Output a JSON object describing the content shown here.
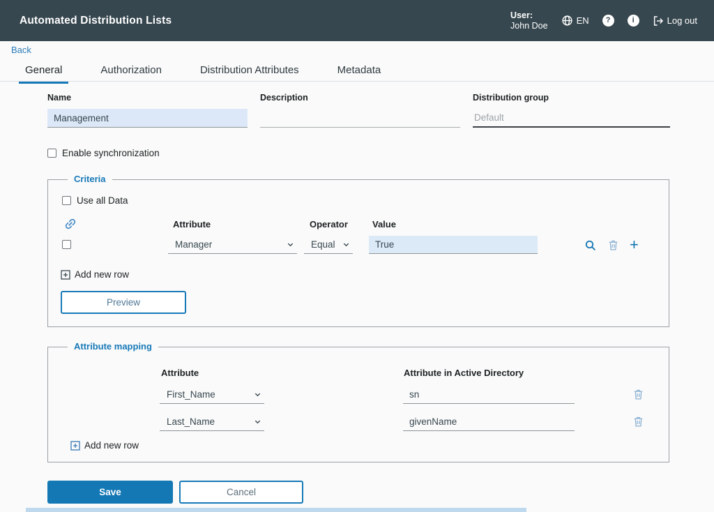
{
  "header": {
    "title": "Automated Distribution Lists",
    "user_label": "User:",
    "user_name": "John Doe",
    "language": "EN",
    "help_glyph": "?",
    "info_glyph": "i",
    "logout_label": "Log out"
  },
  "nav": {
    "back_label": "Back",
    "tabs": [
      {
        "label": "General",
        "active": true
      },
      {
        "label": "Authorization",
        "active": false
      },
      {
        "label": "Distribution Attributes",
        "active": false
      },
      {
        "label": "Metadata",
        "active": false
      }
    ]
  },
  "form": {
    "name": {
      "label": "Name",
      "value": "Management"
    },
    "description": {
      "label": "Description",
      "value": ""
    },
    "distribution_group": {
      "label": "Distribution group",
      "value": "Default"
    },
    "enable_sync_label": "Enable synchronization"
  },
  "criteria": {
    "legend": "Criteria",
    "use_all_data_label": "Use all Data",
    "columns": {
      "attribute": "Attribute",
      "operator": "Operator",
      "value": "Value"
    },
    "rows": [
      {
        "attribute": "Manager",
        "operator": "Equal",
        "value": "True"
      }
    ],
    "add_new_row_label": "Add new row",
    "preview_label": "Preview"
  },
  "attribute_mapping": {
    "legend": "Attribute mapping",
    "columns": {
      "attribute": "Attribute",
      "ad_attribute": "Attribute in Active Directory"
    },
    "rows": [
      {
        "attribute": "First_Name",
        "ad_attribute": "sn"
      },
      {
        "attribute": "Last_Name",
        "ad_attribute": "givenName"
      }
    ],
    "add_new_row_label": "Add new row"
  },
  "actions": {
    "save_label": "Save",
    "cancel_label": "Cancel"
  },
  "colors": {
    "header_bg": "#37474f",
    "accent": "#1779b8",
    "highlight_bg": "#dce9f7"
  }
}
